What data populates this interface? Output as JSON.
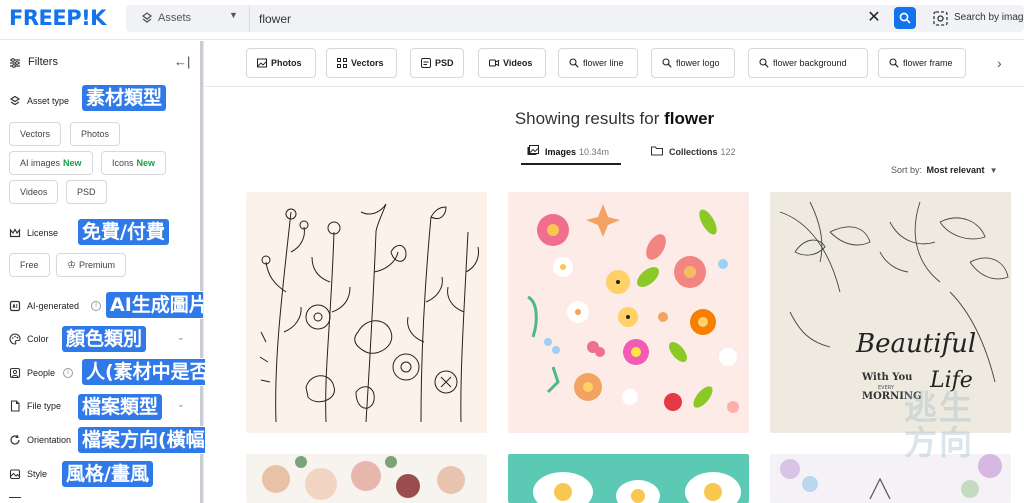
{
  "header": {
    "logo": "FREEP!K",
    "asset_select_label": "Assets",
    "search_value": "flower",
    "image_search_label": "Search by image"
  },
  "sidebar": {
    "title": "Filters",
    "asset_type_label": "Asset type",
    "asset_chips": [
      {
        "label": "Vectors",
        "badge": ""
      },
      {
        "label": "Photos",
        "badge": ""
      },
      {
        "label": "AI images",
        "badge": "New"
      },
      {
        "label": "Icons",
        "badge": "New"
      },
      {
        "label": "Videos",
        "badge": ""
      },
      {
        "label": "PSD",
        "badge": ""
      }
    ],
    "license_label": "License",
    "license_chips": [
      "Free",
      "Premium"
    ],
    "ai_generated_label": "AI-generated",
    "color_label": "Color",
    "people_label": "People",
    "file_type_label": "File type",
    "orientation_label": "Orientation",
    "style_label": "Style"
  },
  "annotations": {
    "asset_type": "素材類型",
    "license": "免費/付費",
    "ai_generated": "AI生成圖片",
    "color": "顏色類別",
    "people": "人(素材中是否有出現)",
    "file_type": "檔案類型",
    "orientation": "檔案方向(橫幅/直式)",
    "style": "風格/畫風"
  },
  "tags": [
    {
      "label": "Photos",
      "icon": "photo-icon"
    },
    {
      "label": "Vectors",
      "icon": "vector-icon"
    },
    {
      "label": "PSD",
      "icon": "psd-icon"
    },
    {
      "label": "Videos",
      "icon": "video-icon"
    },
    {
      "label": "flower line",
      "icon": "search-icon"
    },
    {
      "label": "flower logo",
      "icon": "search-icon"
    },
    {
      "label": "flower background",
      "icon": "search-icon"
    },
    {
      "label": "flower frame",
      "icon": "search-icon"
    }
  ],
  "results": {
    "prefix": "Showing results for ",
    "query": "flower",
    "tab_images_label": "Images",
    "tab_images_count": "10.34m",
    "tab_collections_label": "Collections",
    "tab_collections_count": "122",
    "sort_label": "Sort by:",
    "sort_value": "Most relevant"
  },
  "cards": {
    "card3_text_1": "Beautiful",
    "card3_text_2": "Life",
    "card3_text_3": "With You",
    "card3_text_4": "EVERY",
    "card3_text_5": "MORNING"
  },
  "watermark": "逃生方向",
  "colors": {
    "brand": "#1273eb",
    "annotation": "#2f79e8",
    "new_badge": "#16a34a"
  }
}
